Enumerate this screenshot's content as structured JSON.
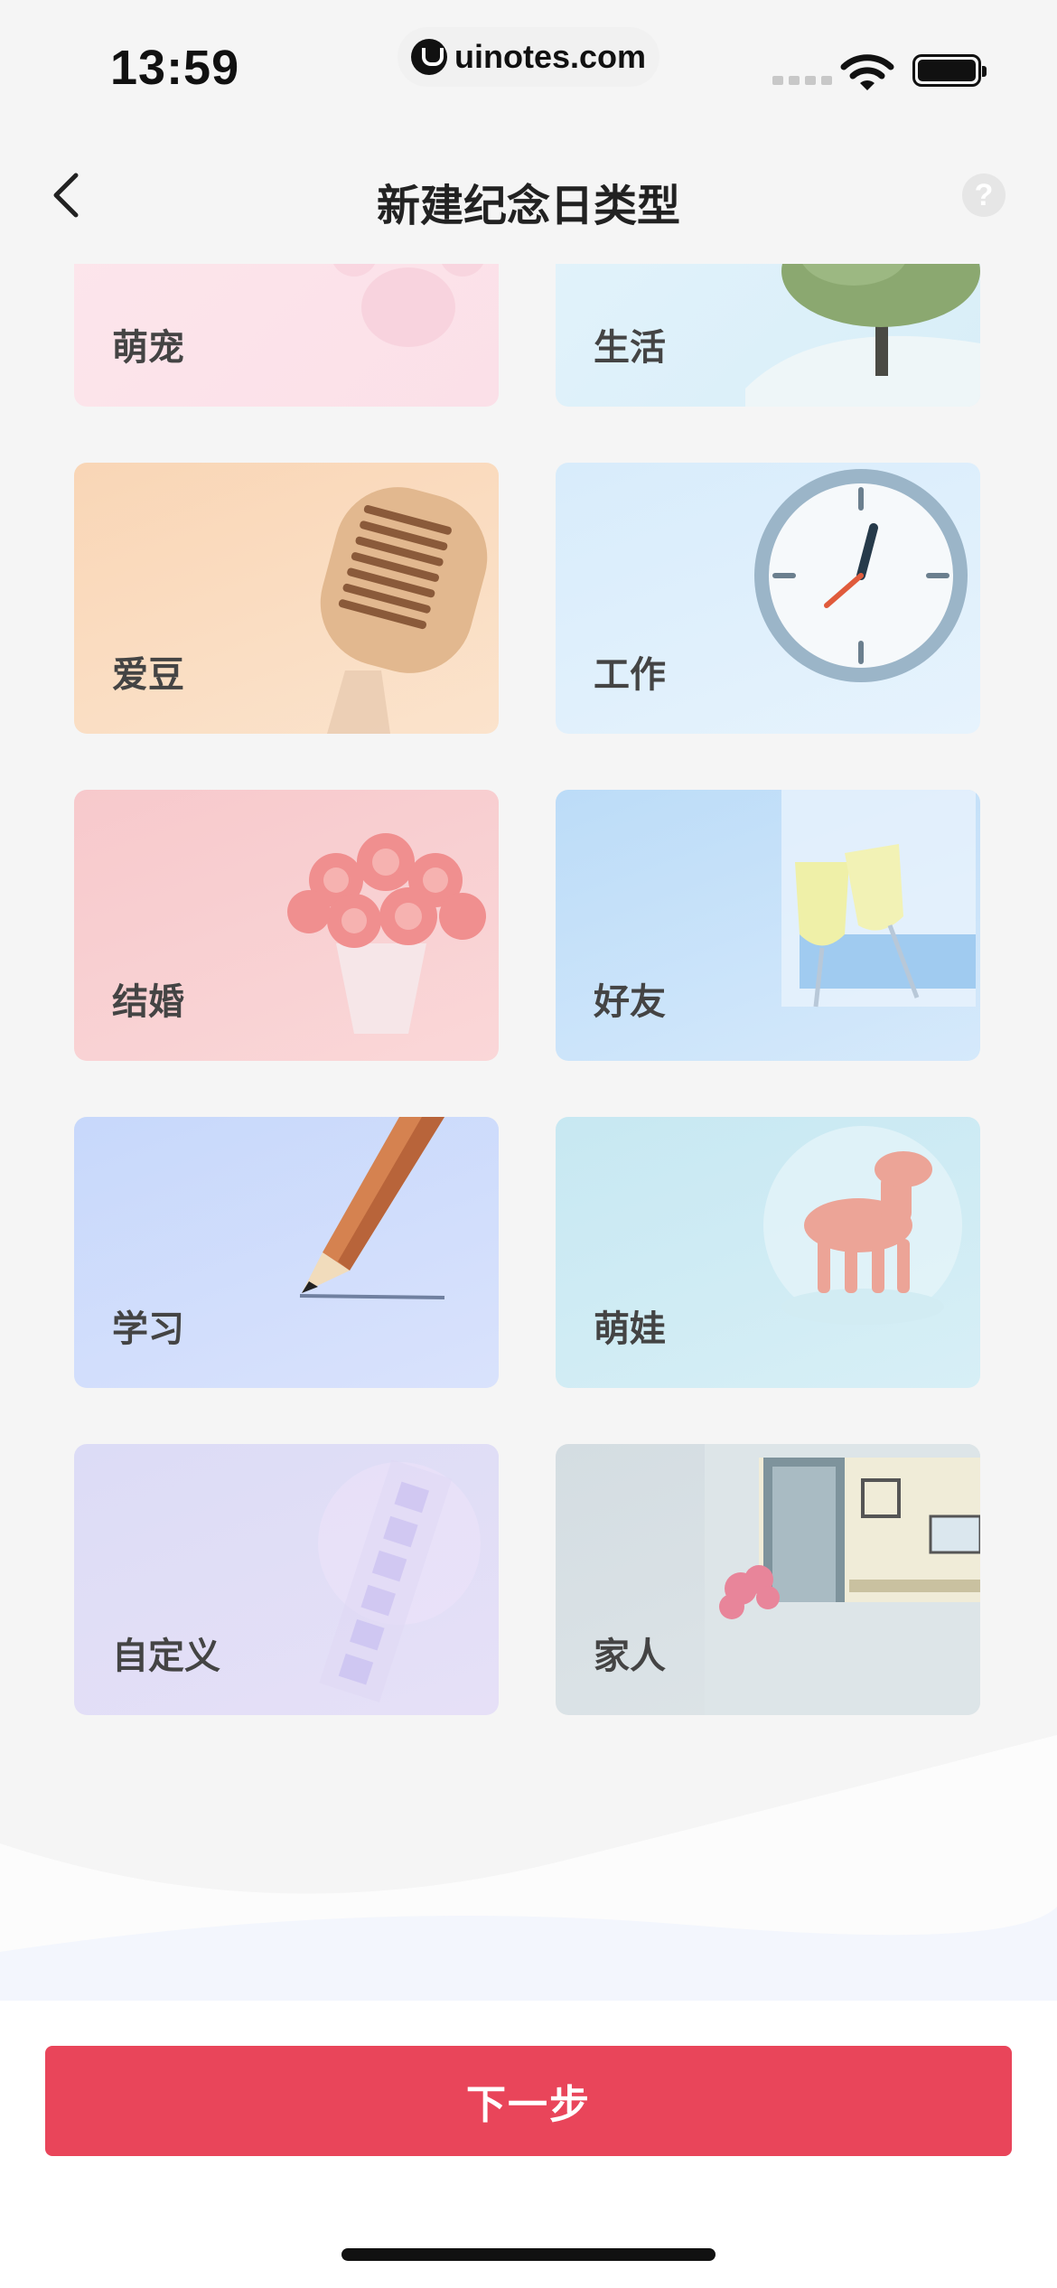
{
  "status_bar": {
    "time": "13:59",
    "url": "uinotes.com"
  },
  "nav": {
    "title": "新建纪念日类型",
    "back_icon": "chevron-left-icon",
    "help_label": "?"
  },
  "categories": [
    {
      "label": "萌宠"
    },
    {
      "label": "生活"
    },
    {
      "label": "爱豆"
    },
    {
      "label": "工作"
    },
    {
      "label": "结婚"
    },
    {
      "label": "好友"
    },
    {
      "label": "学习"
    },
    {
      "label": "萌娃"
    },
    {
      "label": "自定义"
    },
    {
      "label": "家人"
    }
  ],
  "footer": {
    "next_label": "下一步"
  },
  "colors": {
    "primary": "#e9455a",
    "background": "#f5f5f5"
  }
}
